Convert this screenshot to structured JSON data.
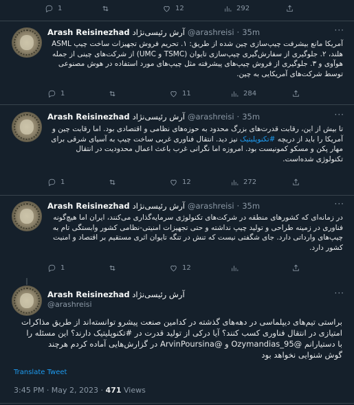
{
  "top_actions": {
    "replies": "1",
    "retweets": "",
    "likes": "12",
    "views": "292"
  },
  "tweets": [
    {
      "name": "Arash Reisinezhad",
      "name_fa": "آرش رئیسی‌نژاد",
      "handle": "@arashreisi",
      "time": "35m",
      "text_parts": [
        "آمریکا مانع بیشرفت چیپ‌سازی چین شده از طریق: ۱. تحریم فروش تجهیزات ساخت چیپ ASML هلند، ۲. جلوگیری از سفارش‌گیری چیپ‌سازی تایوان (TSMC و UMC) از شرکت‌های چینی از جمله هوآوی و ۳. جلوگیری از فروش چیپ‌های پیشرفته مثل چیپ‌های مورد استفاده در هوش مصنوعی توسط شرکت‌های آمریکایی به چین."
      ],
      "replies": "1",
      "retweets": "",
      "likes": "11",
      "views": "284"
    },
    {
      "name": "Arash Reisinezhad",
      "name_fa": "آرش رئیسی‌نژاد",
      "handle": "@arashreisi",
      "time": "35m",
      "text_before": "تا بیش از این، رقابت قدرت‌های بزرگ محدود به حوزه‌های نظامی و اقتصادی بود. اما رقابت چین و آمریکا را باید از دریچه ",
      "hashtag": "#تکنوپلیتیک",
      "text_after": " نیز دید. انتقال فناوری غربی ساخت چیپ به آسیای شرقی برای مهار پکن و مسکو کمونیست بود. امروزه اما نگرانی غرب باعث اعمال محدودیت در انتقال تکنولوژی شده‌است.",
      "replies": "1",
      "retweets": "",
      "likes": "12",
      "views": "272"
    },
    {
      "name": "Arash Reisinezhad",
      "name_fa": "آرش رئیسی‌نژاد",
      "handle": "@arashreisi",
      "time": "35m",
      "text_parts": [
        "در زمانه‌ای که کشورهای منطقه در شرکت‌های تکنولوژی سرمایه‌گذاری می‌کنند، ایران اما هیچ‌گونه فناوری در زمینه طراحی و تولید چیپ نداشته و حتی تجهیزات امنیتی-نظامی کشور وابستگی تام به چیپ‌های وارداتی دارد. جای شگفتی نیست که تنش در تنگه تایوان اثری مستقیم بر اقتصاد و امنیت کشور دارد."
      ],
      "replies": "1",
      "retweets": "",
      "likes": "12",
      "views": ""
    }
  ],
  "main_tweet": {
    "name": "Arash Reisinezhad",
    "name_fa": "آرش رئیسی‌نژاد",
    "handle": "@arashreisi",
    "line1": "براستی تیم‌های دیپلماسی در دهه‌های گذشته در کدامین صنعت پیشرو توانسته‌اند از طریق مذاکرات",
    "line2_before": "امتیازی در انتقال فناوری کسب کنند؟ آیا درکی از تولید قدرت در ",
    "hashtag": "#تکنوپلیتیک",
    "line2_after": " دارند؟ این مسئله را",
    "line3_before": "با دستیارانم ",
    "mention1": "@Ozymandias_95",
    "line3_mid": " و ",
    "mention2": "@ArvinPoursina",
    "line3_after": " در گزارش‌هایی آماده کردم هرچند",
    "line4": "گوش شنوایی نخواهد بود",
    "translate": "Translate Tweet",
    "time": "3:45 PM · May 2, 2023 · ",
    "views_count": "471",
    "views_label": " Views"
  },
  "icons": [
    "reply-icon",
    "retweet-icon",
    "like-icon",
    "views-icon",
    "share-icon",
    "more-icon"
  ],
  "colors": {
    "background": "#15202b",
    "link": "#1d9bf0",
    "muted": "#8b98a5",
    "divider": "#38444d"
  }
}
